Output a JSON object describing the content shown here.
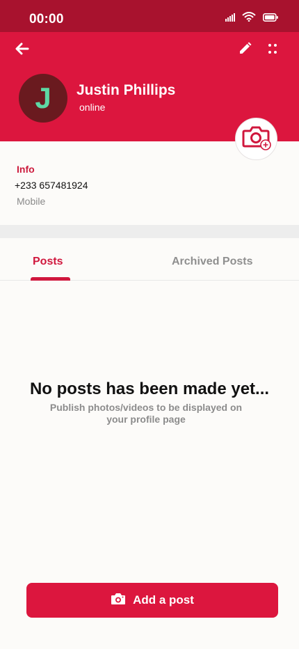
{
  "status_bar": {
    "time": "00:00"
  },
  "profile": {
    "initial": "J",
    "name": "Justin Phillips",
    "status": "online"
  },
  "info": {
    "title": "Info",
    "phone": "+233 657481924",
    "phone_type": "Mobile"
  },
  "tabs": [
    {
      "label": "Posts",
      "selected": true
    },
    {
      "label": "Archived Posts",
      "selected": false
    }
  ],
  "empty_state": {
    "title": "No posts has been made yet...",
    "subtitle": "Publish photos/videos to be displayed on your profile page"
  },
  "actions": {
    "add_post_label": "Add a post"
  },
  "colors": {
    "primary": "#dc163e",
    "status_bar": "#a8122e",
    "avatar_bg": "#6a1a1f",
    "avatar_text": "#5ed8a4"
  },
  "icons": [
    "signal-icon",
    "wifi-icon",
    "battery-icon",
    "back-arrow-icon",
    "edit-pencil-icon",
    "more-dots-icon",
    "add-photo-camera-icon",
    "camera-icon"
  ]
}
